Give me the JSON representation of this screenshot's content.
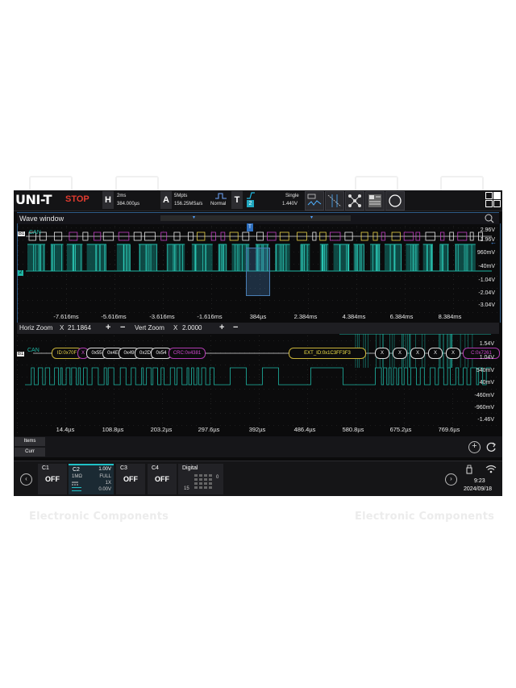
{
  "brand": "UNI-T",
  "run_state": "STOP",
  "horizontal": {
    "key": "H",
    "timebase": "2ms",
    "position": "384.000µs"
  },
  "acquire": {
    "key": "A",
    "memory": "5Mpts",
    "sample_rate": "156.25MSa/s",
    "mode": "Normal"
  },
  "trigger": {
    "key": "T",
    "source": "2",
    "sweep": "Single",
    "level": "1.440V"
  },
  "watermark": "Electronic Components",
  "wave_window": {
    "title": "Wave window",
    "bus_label": "B1",
    "bus_name": "CAN",
    "channel_marker": "2",
    "volt_labels": [
      "2.96V",
      "1.96V",
      "960mV",
      "-40mV",
      "-1.04V",
      "-2.04V",
      "-3.04V"
    ],
    "time_labels": [
      "-7.616ms",
      "-5.616ms",
      "-3.616ms",
      "-1.616ms",
      "384µs",
      "2.384ms",
      "4.384ms",
      "6.384ms",
      "8.384ms"
    ]
  },
  "zoom": {
    "horiz_label": "Horiz Zoom",
    "horiz_x": "X",
    "horiz_value": "21.1864",
    "vert_label": "Vert Zoom",
    "vert_x": "X",
    "vert_value": "2.0000",
    "plus": "+",
    "minus": "−",
    "bus_label": "B1",
    "bus_name": "CAN",
    "volt_labels": [
      "1.54V",
      "1.04V",
      "540mV",
      "40mV",
      "-460mV",
      "-960mV",
      "-1.46V"
    ],
    "time_labels": [
      "14.4µs",
      "108.8µs",
      "203.2µs",
      "297.6µs",
      "392µs",
      "486.4µs",
      "580.8µs",
      "675.2µs",
      "769.6µs"
    ],
    "packets": [
      {
        "text": "ID:0x70F"
      },
      {
        "text": "X"
      },
      {
        "text": "0x55"
      },
      {
        "text": "0x4E"
      },
      {
        "text": "0x49"
      },
      {
        "text": "0x2D"
      },
      {
        "text": "0x54"
      },
      {
        "text": "CRC:0x4381"
      },
      {
        "text": "EXT_ID:0x1C3FF3F3"
      },
      {
        "text": "X"
      },
      {
        "text": "X"
      },
      {
        "text": "X"
      },
      {
        "text": "X"
      },
      {
        "text": "X"
      },
      {
        "text": "C:0x7261"
      }
    ]
  },
  "items": {
    "items_label": "Items",
    "curr_label": "Curr"
  },
  "channels": [
    {
      "name": "C1",
      "state": "OFF"
    },
    {
      "name": "C2",
      "scale": "1.00V",
      "impedance": "1MΩ",
      "bandwidth": "FULL",
      "probe": "1X",
      "coupling": "",
      "offset": "0.00V"
    },
    {
      "name": "C3",
      "state": "OFF"
    },
    {
      "name": "C4",
      "state": "OFF"
    }
  ],
  "digital": {
    "label": "Digital",
    "d0": "0",
    "d15": "15"
  },
  "status": {
    "time": "9:23",
    "date": "2024/09/18"
  },
  "colors": {
    "trace": "#1fb6a4",
    "bus_packet": "#e9d34a",
    "crc": "#c040c0",
    "accent": "#2e5a86",
    "stop": "#e23b2f"
  }
}
